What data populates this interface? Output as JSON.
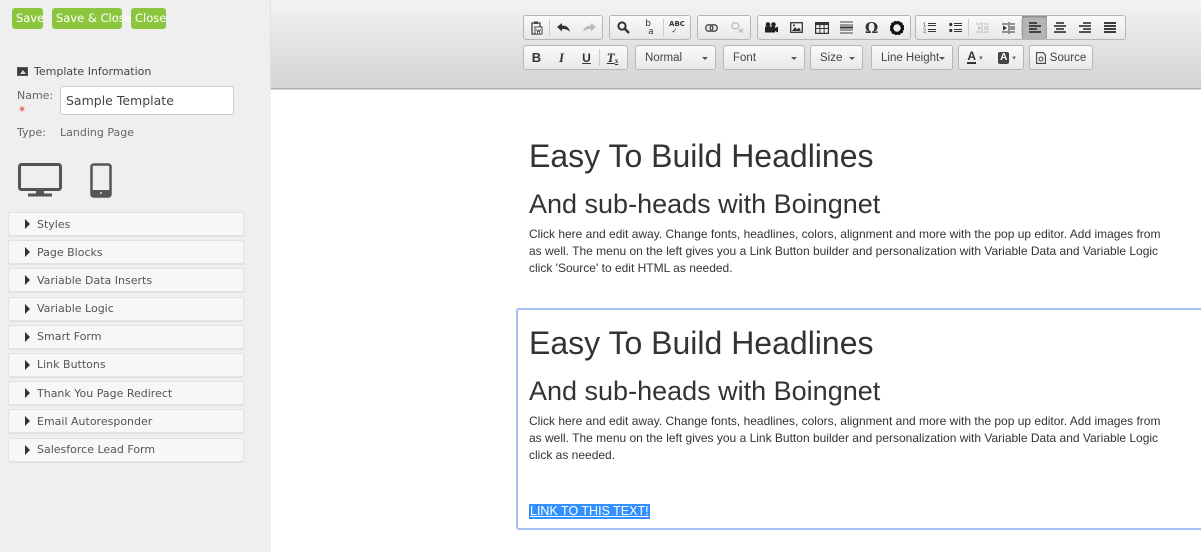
{
  "sidebar": {
    "buttons": {
      "save": "Save",
      "save_close": "Save & Close",
      "close": "Close"
    },
    "section_title": "Template Information",
    "section_icon": "image-icon",
    "name_label": "Name:",
    "required_marker": "*",
    "name_value": "Sample Template",
    "type_label": "Type:",
    "type_value": "Landing Page",
    "devices": [
      "desktop-icon",
      "mobile-icon"
    ],
    "accordion": [
      {
        "label": "Styles"
      },
      {
        "label": "Page Blocks"
      },
      {
        "label": "Variable Data Inserts"
      },
      {
        "label": "Variable Logic"
      },
      {
        "label": "Smart Form"
      },
      {
        "label": "Link Buttons"
      },
      {
        "label": "Thank You Page Redirect"
      },
      {
        "label": "Email Autoresponder"
      },
      {
        "label": "Salesforce Lead Form"
      }
    ],
    "button_color": "#8cc63f"
  },
  "toolbar": {
    "row1": {
      "paste_icon": "paste-from-word-icon",
      "undo_icon": "undo-icon",
      "redo_icon": "redo-icon",
      "find_icon": "find-icon",
      "replace_icon": "replace-icon",
      "spellcheck_icon": "spellcheck-icon",
      "link_icon": "link-icon",
      "unlink_icon": "unlink-icon",
      "video_icon": "video-icon",
      "image_icon": "image-icon",
      "table_icon": "table-icon",
      "hr_icon": "horizontal-rule-icon",
      "special_char": "Ω",
      "settings_icon": "gear-icon",
      "ol_icon": "numbered-list-icon",
      "ul_icon": "bulleted-list-icon",
      "outdent_icon": "outdent-icon",
      "indent_icon": "indent-icon",
      "align_left_icon": "align-left-icon",
      "align_center_icon": "align-center-icon",
      "align_right_icon": "align-right-icon",
      "justify_icon": "justify-icon",
      "active_alignment": "left"
    },
    "row2": {
      "bold": "B",
      "italic": "I",
      "underline": "U",
      "clear_format": "T",
      "format_select": "Normal",
      "font_select": "Font",
      "size_select": "Size",
      "line_height_select": "Line Height",
      "text_color": "A",
      "bg_color": "A",
      "source_label": "Source"
    }
  },
  "content": {
    "blocks": [
      {
        "headline": "Easy To Build Headlines",
        "subhead": "And sub-heads with Boingnet",
        "paragraph_lines": [
          "Click here and edit away. Change fonts, headlines, colors, alignment and more with the pop up editor. Add images from",
          "as well. The menu on the left gives you a Link Button builder and personalization with Variable Data and Variable Logic",
          "click 'Source' to edit HTML as needed."
        ]
      },
      {
        "headline": "Easy To Build Headlines",
        "subhead": "And sub-heads with Boingnet",
        "paragraph_lines": [
          "Click here and edit away. Change fonts, headlines, colors, alignment and more with the pop up editor. Add images from",
          "as well. The menu on the left gives you a Link Button builder and personalization with Variable Data and Variable Logic",
          "click as needed."
        ],
        "selected_link": "LINK TO THIS TEXT!"
      }
    ],
    "selection_color": "#3390ff",
    "focus_border_color": "#a4bff3"
  }
}
